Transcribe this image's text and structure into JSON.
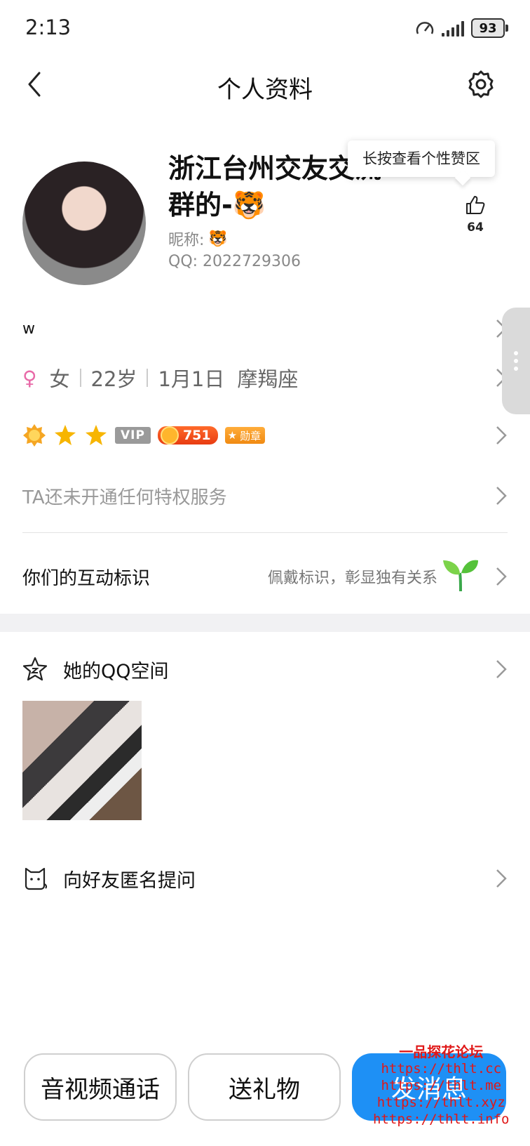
{
  "status_bar": {
    "time": "2:13",
    "battery": "93"
  },
  "header": {
    "title": "个人资料",
    "icons": {
      "back": "chevron-left-icon",
      "settings": "gear-icon"
    }
  },
  "profile": {
    "display_name": "浙江台州交友交流群的-🐯",
    "nickname_label": "昵称:",
    "nickname_value": "🐯",
    "qq": "QQ: 2022729306",
    "tooltip": "长按查看个性赞区",
    "like_count": "64"
  },
  "signature": "w",
  "info": {
    "gender_symbol": "♀",
    "gender": "女",
    "age": "22岁",
    "birthday": "1月1日",
    "zodiac": "摩羯座"
  },
  "badges": {
    "vip": "VIP",
    "coin": "751",
    "medal": "勋章"
  },
  "privilege": "TA还未开通任何特权服务",
  "interaction": {
    "title": "你们的互动标识",
    "hint": "佩戴标识，彰显独有关系"
  },
  "qzone": {
    "title": "她的QQ空间"
  },
  "ask": {
    "title": "向好友匿名提问"
  },
  "bottom_buttons": {
    "call": "音视频通话",
    "gift": "送礼物",
    "message": "发消息"
  },
  "watermark": {
    "title": "一品探花论坛",
    "links": [
      "https://thlt.cc",
      "https://thlt.me",
      "https://thlt.xyz",
      "https://thlt.info"
    ]
  },
  "colors": {
    "accent": "#1e90f5",
    "gender_female": "#e86aa8",
    "watermark": "#e01818"
  }
}
